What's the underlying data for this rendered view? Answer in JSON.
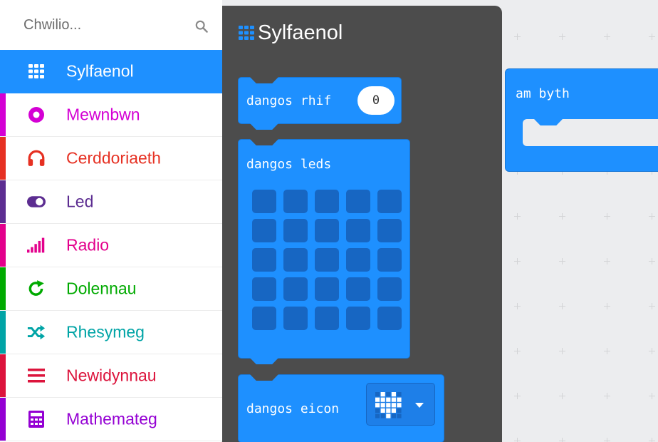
{
  "search": {
    "placeholder": "Chwilio..."
  },
  "categories": [
    {
      "id": "basic",
      "label": "Sylfaenol",
      "icon": "grid-icon",
      "color": "#1e90ff",
      "active": true
    },
    {
      "id": "input",
      "label": "Mewnbwn",
      "icon": "target-icon",
      "color": "#d400d4",
      "active": false
    },
    {
      "id": "music",
      "label": "Cerddoriaeth",
      "icon": "headphones-icon",
      "color": "#e63022",
      "active": false
    },
    {
      "id": "led",
      "label": "Led",
      "icon": "toggle-icon",
      "color": "#5c2d91",
      "active": false
    },
    {
      "id": "radio",
      "label": "Radio",
      "icon": "signal-bars-icon",
      "color": "#e3008c",
      "active": false
    },
    {
      "id": "loops",
      "label": "Dolennau",
      "icon": "loop-arrow-icon",
      "color": "#00aa00",
      "active": false
    },
    {
      "id": "logic",
      "label": "Rhesymeg",
      "icon": "shuffle-icon",
      "color": "#00a4a6",
      "active": false
    },
    {
      "id": "variables",
      "label": "Newidynnau",
      "icon": "lines-icon",
      "color": "#dc143c",
      "active": false
    },
    {
      "id": "math",
      "label": "Mathemateg",
      "icon": "calculator-icon",
      "color": "#9400d3",
      "active": false
    }
  ],
  "flyout": {
    "title": "Sylfaenol",
    "blocks": {
      "show_number": {
        "label": "dangos rhif",
        "value": "0"
      },
      "show_leds": {
        "label": "dangos leds"
      },
      "show_icon": {
        "label": "dangos eicon"
      }
    }
  },
  "workspace": {
    "forever": {
      "label": "am byth"
    }
  },
  "colors": {
    "basic_block": "#1e90ff",
    "flyout_bg": "#4c4c4c",
    "workspace_bg": "#ecedef",
    "led_off": "#1766c2"
  }
}
